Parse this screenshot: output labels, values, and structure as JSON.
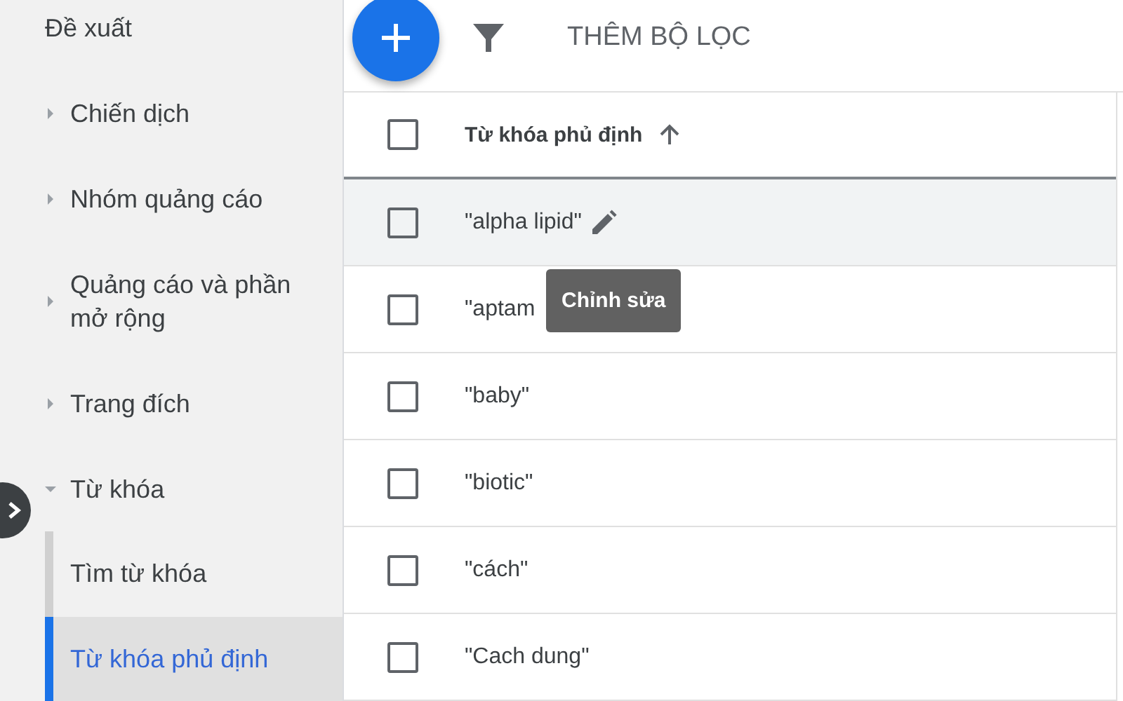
{
  "sidebar": {
    "items": [
      {
        "label": "Đề xuất",
        "selected": false
      },
      {
        "label": "Chiến dịch",
        "expanded": false,
        "selected": false
      },
      {
        "label": "Nhóm quảng cáo",
        "expanded": false,
        "selected": false
      },
      {
        "label": "Quảng cáo và phần mở rộng",
        "expanded": false,
        "selected": false
      },
      {
        "label": "Trang đích",
        "expanded": false,
        "selected": false
      },
      {
        "label": "Từ khóa",
        "expanded": true,
        "selected": false,
        "children": [
          {
            "label": "Tìm từ khóa",
            "selected": false
          },
          {
            "label": "Từ khóa phủ định",
            "selected": true
          }
        ]
      }
    ]
  },
  "toolbar": {
    "add_filter": "THÊM BỘ LỌC"
  },
  "table": {
    "all_checked": false,
    "columns": [
      {
        "label": "Từ khóa phủ định",
        "sort_ascending": true
      }
    ],
    "rows": [
      {
        "keyword": "\"alpha lipid\"",
        "hovered": true,
        "checked": false,
        "tooltip": "Chỉnh sửa"
      },
      {
        "keyword": "\"aptam",
        "hovered": false,
        "checked": false
      },
      {
        "keyword": "\"baby\"",
        "hovered": false,
        "checked": false
      },
      {
        "keyword": "\"biotic\"",
        "hovered": false,
        "checked": false
      },
      {
        "keyword": "\"cách\"",
        "hovered": false,
        "checked": false
      },
      {
        "keyword": "\"Cach dung\"",
        "hovered": false,
        "checked": false
      }
    ]
  }
}
